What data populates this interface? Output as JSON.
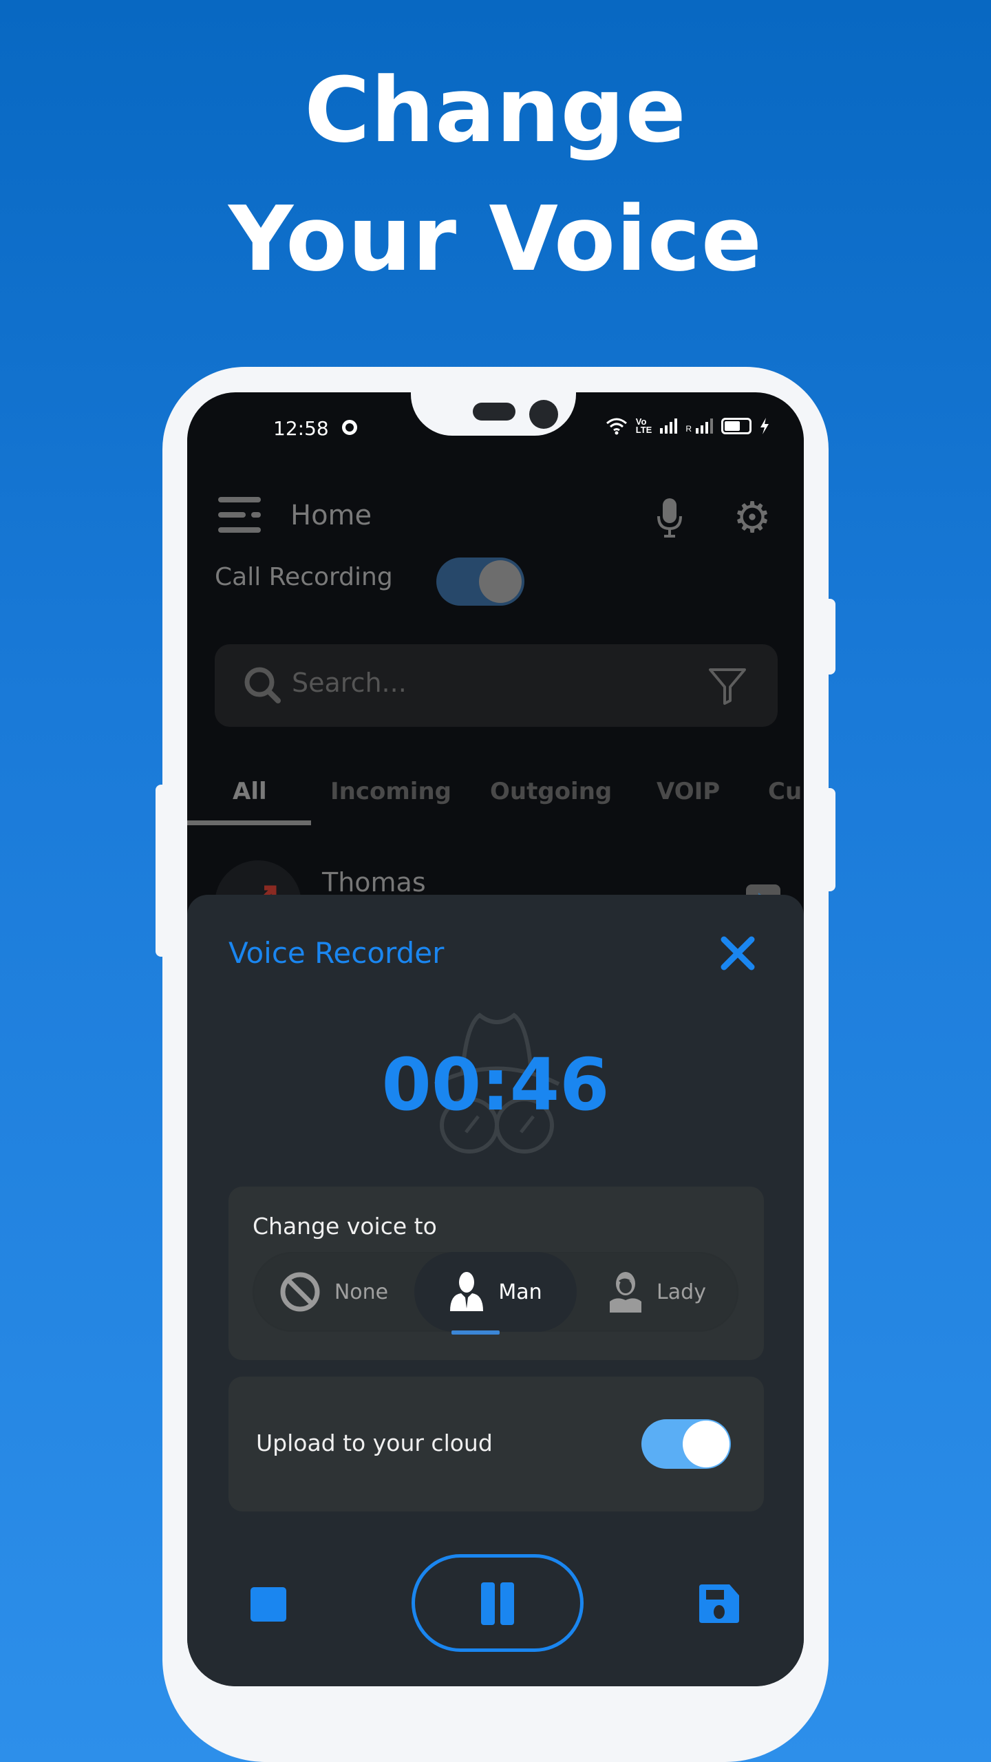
{
  "headline": {
    "line1": "Change",
    "line2": "Your Voice"
  },
  "colors": {
    "accent": "#1a86f0",
    "background_top": "#0868c2",
    "background_bottom": "#2d8fea",
    "sheet_bg": "#242a30",
    "card_bg": "#2e3335",
    "toggle_on": "#5aaef5"
  },
  "status_bar": {
    "time": "12:58",
    "icons": [
      "record-indicator-icon",
      "wifi-icon",
      "volte-icon",
      "signal-icon",
      "roaming-signal-icon",
      "battery-icon",
      "charging-icon"
    ],
    "volte_label": "Vo\nLTE",
    "roaming_label": "R"
  },
  "app_header": {
    "title": "Home",
    "menu_icon": "menu-icon",
    "mic_icon": "microphone-icon",
    "settings_icon": "gear-icon"
  },
  "call_recording": {
    "label": "Call Recording",
    "enabled": true
  },
  "search": {
    "placeholder": "Search...",
    "value": ""
  },
  "tabs": [
    {
      "label": "All",
      "active": true
    },
    {
      "label": "Incoming",
      "active": false
    },
    {
      "label": "Outgoing",
      "active": false
    },
    {
      "label": "VOIP",
      "active": false
    },
    {
      "label": "Cu",
      "active": false
    }
  ],
  "call_list": [
    {
      "name": "Thomas",
      "type_icon": "outgoing-call-icon"
    }
  ],
  "voice_recorder": {
    "title": "Voice Recorder",
    "timer": "00:46",
    "change_voice": {
      "label": "Change voice to",
      "options": [
        {
          "label": "None",
          "icon": "none-icon",
          "selected": false
        },
        {
          "label": "Man",
          "icon": "man-icon",
          "selected": true
        },
        {
          "label": "Lady",
          "icon": "lady-icon",
          "selected": false
        }
      ]
    },
    "cloud_upload": {
      "label": "Upload to your cloud",
      "enabled": true
    },
    "controls": {
      "stop": "stop-icon",
      "pause": "pause-icon",
      "save": "save-icon"
    }
  }
}
